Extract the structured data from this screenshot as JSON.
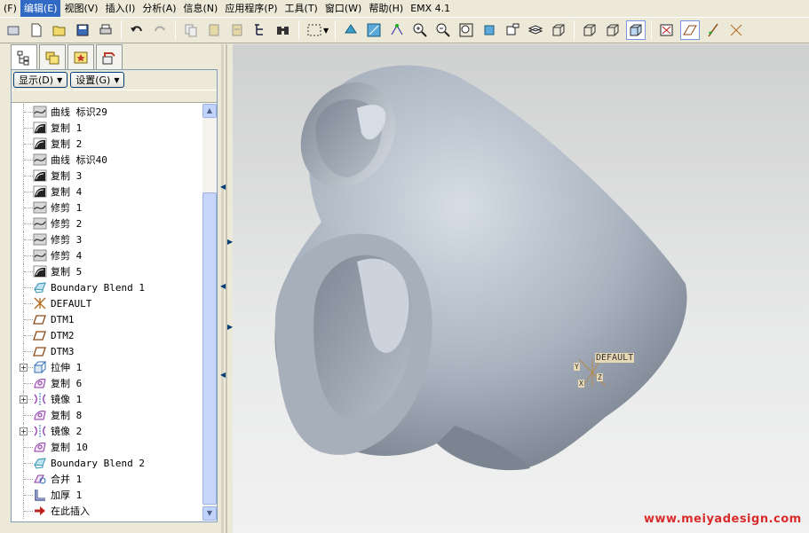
{
  "menubar": {
    "items": [
      {
        "label": "(F)"
      },
      {
        "label": "编辑(E)",
        "active": true
      },
      {
        "label": "视图(V)"
      },
      {
        "label": "插入(I)"
      },
      {
        "label": "分析(A)"
      },
      {
        "label": "信息(N)"
      },
      {
        "label": "应用程序(P)"
      },
      {
        "label": "工具(T)"
      },
      {
        "label": "窗口(W)"
      },
      {
        "label": "帮助(H)"
      },
      {
        "label": "EMX 4.1"
      }
    ]
  },
  "toolbar": {
    "icons": [
      "regenerate-icon",
      "new-file-icon",
      "open-folder-icon",
      "save-icon",
      "print-icon",
      "undo-icon",
      "redo-icon",
      "copy-icon",
      "paste-icon",
      "paste-special-icon",
      "model-tree-icon",
      "find-icon",
      "select-box-icon",
      "orient-icon",
      "refit-icon",
      "spin-center-icon",
      "zoom-in-icon",
      "zoom-out-icon",
      "zoom-fit-icon",
      "view-manager-icon",
      "saved-views-icon",
      "layers-icon",
      "wireframe-icon",
      "hidden-line-icon",
      "no-hidden-icon",
      "shading-icon",
      "datum-plane-toggle-icon",
      "datum-axis-toggle-icon",
      "datum-point-toggle-icon",
      "csys-toggle-icon"
    ]
  },
  "navigator": {
    "tabs": [
      {
        "name": "model-tree-tab",
        "icon": "tree-icon"
      },
      {
        "name": "folder-browser-tab",
        "icon": "folders-icon"
      },
      {
        "name": "favorites-tab",
        "icon": "favorites-icon"
      },
      {
        "name": "connections-tab",
        "icon": "connections-icon"
      }
    ],
    "show_button": "显示(D)",
    "settings_button": "设置(G)"
  },
  "model_tree": {
    "items": [
      {
        "label": "曲线 标识29",
        "icon": "curve-icon",
        "expandable": false
      },
      {
        "label": "复制 1",
        "icon": "surface-copy-icon",
        "expandable": false
      },
      {
        "label": "复制 2",
        "icon": "surface-copy-icon",
        "expandable": false
      },
      {
        "label": "曲线 标识40",
        "icon": "curve-icon",
        "expandable": false
      },
      {
        "label": "复制 3",
        "icon": "surface-copy-icon",
        "expandable": false
      },
      {
        "label": "复制 4",
        "icon": "surface-copy-icon",
        "expandable": false
      },
      {
        "label": "修剪 1",
        "icon": "curve-icon",
        "expandable": false
      },
      {
        "label": "修剪 2",
        "icon": "curve-icon",
        "expandable": false
      },
      {
        "label": "修剪 3",
        "icon": "curve-icon",
        "expandable": false
      },
      {
        "label": "修剪 4",
        "icon": "curve-icon",
        "expandable": false
      },
      {
        "label": "复制 5",
        "icon": "surface-copy-icon",
        "expandable": false
      },
      {
        "label": "Boundary Blend 1",
        "icon": "boundary-blend-icon",
        "expandable": false
      },
      {
        "label": "DEFAULT",
        "icon": "csys-icon",
        "expandable": false
      },
      {
        "label": "DTM1",
        "icon": "datum-plane-icon",
        "expandable": false
      },
      {
        "label": "DTM2",
        "icon": "datum-plane-icon",
        "expandable": false
      },
      {
        "label": "DTM3",
        "icon": "datum-plane-icon",
        "expandable": false
      },
      {
        "label": "拉伸 1",
        "icon": "extrude-icon",
        "expandable": true
      },
      {
        "label": "复制 6",
        "icon": "copy-surface-purple-icon",
        "expandable": false
      },
      {
        "label": "镜像 1",
        "icon": "mirror-icon",
        "expandable": true
      },
      {
        "label": "复制 8",
        "icon": "copy-surface-purple-icon",
        "expandable": false
      },
      {
        "label": "镜像 2",
        "icon": "mirror-icon",
        "expandable": true
      },
      {
        "label": "复制 10",
        "icon": "copy-surface-purple-icon",
        "expandable": false
      },
      {
        "label": "Boundary Blend 2",
        "icon": "boundary-blend-icon",
        "expandable": false
      },
      {
        "label": "合并 1",
        "icon": "merge-icon",
        "expandable": false
      },
      {
        "label": "加厚 1",
        "icon": "thicken-icon",
        "expandable": false
      },
      {
        "label": "在此插入",
        "icon": "insert-here-icon",
        "expandable": false
      }
    ]
  },
  "graphics": {
    "csys_label": "DEFAULT",
    "csys_axes": {
      "x": "X",
      "y": "Y",
      "z": "Z"
    },
    "watermark": "www.meiyadesign.com"
  },
  "colors": {
    "menu_active": "#316ac5",
    "model_surface": "#9fa9b6",
    "watermark": "#d92b2b",
    "csys_tag": "#e8d9b6"
  }
}
